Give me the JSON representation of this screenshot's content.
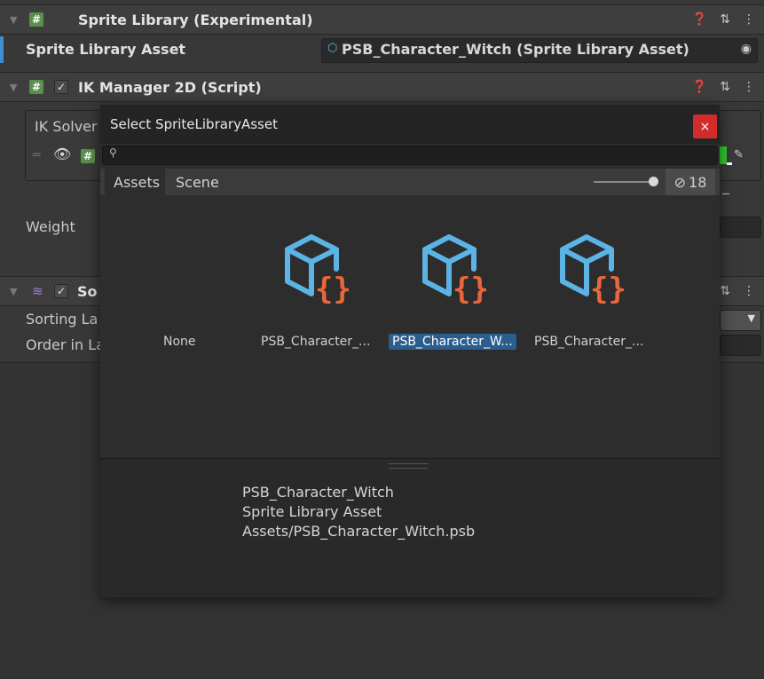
{
  "inspector": {
    "sprite_library": {
      "title": "Sprite Library (Experimental)",
      "asset_label": "Sprite Library Asset",
      "asset_value": "PSB_Character_Witch (Sprite Library Asset)"
    },
    "ik_manager": {
      "title": "IK Manager 2D (Script)",
      "solver_label": "IK Solver",
      "weight_label": "Weight"
    },
    "sorting_group": {
      "title": "So",
      "sorting_layer_label": "Sorting La",
      "order_label": "Order in La"
    }
  },
  "dialog": {
    "title": "Select SpriteLibraryAsset",
    "close_label": "×",
    "search_placeholder": "",
    "tabs": [
      "Assets",
      "Scene"
    ],
    "hidden_count": "18",
    "items": [
      {
        "label": "None",
        "has_icon": false,
        "selected": false
      },
      {
        "label": "PSB_Character_...",
        "has_icon": true,
        "selected": false
      },
      {
        "label": "PSB_Character_W...",
        "has_icon": true,
        "selected": true
      },
      {
        "label": "PSB_Character_...",
        "has_icon": true,
        "selected": false
      }
    ],
    "preview": {
      "name": "PSB_Character_Witch",
      "type": "Sprite Library Asset",
      "path": "Assets/PSB_Character_Witch.psb"
    }
  },
  "colors": {
    "asset_icon_blue": "#5bb4e5",
    "asset_icon_orange": "#e8673a",
    "selection_blue": "#2c5d8f",
    "close_red": "#d12c2c"
  }
}
